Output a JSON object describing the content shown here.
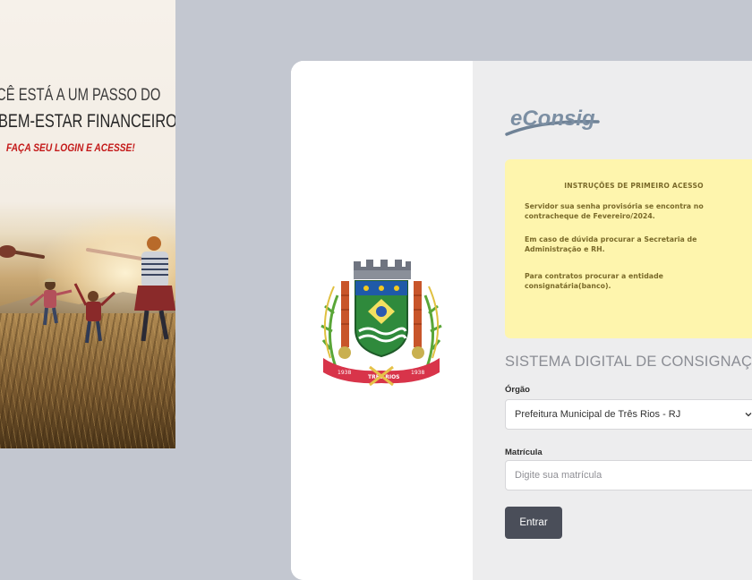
{
  "banner": {
    "line1": "CÊ ESTÁ A UM PASSO DO",
    "line2": "BEM-ESTAR FINANCEIRO.",
    "line3": "FAÇA SEU LOGIN E ACESSE!"
  },
  "crest": {
    "ribbon_left": "1938",
    "ribbon_center": "TRÊS RIOS",
    "ribbon_right": "1938"
  },
  "logo": {
    "text": "eConsig"
  },
  "instructions": {
    "title": "INSTRUÇÕES DE PRIMEIRO ACESSO",
    "p1": "Servidor sua senha provisória se encontra no contracheque de Fevereiro/2024.",
    "p2": "Em caso de dúvida procurar a Secretaria de Administração e RH.",
    "p3": "Para contratos procurar a entidade consignatária(banco)."
  },
  "form": {
    "system_title": "SISTEMA DIGITAL DE CONSIGNAÇÕES",
    "orgao_label": "Órgão",
    "orgao_value": "Prefeitura Municipal de Três Rios - RJ",
    "matricula_label": "Matrícula",
    "matricula_placeholder": "Digite sua matrícula",
    "submit_label": "Entrar"
  },
  "colors": {
    "page_bg": "#c3c7d0",
    "panel_bg": "#ededee",
    "notice_bg": "#fef5ad",
    "button_bg": "#4a4e59",
    "banner_accent": "#c41a1a"
  }
}
